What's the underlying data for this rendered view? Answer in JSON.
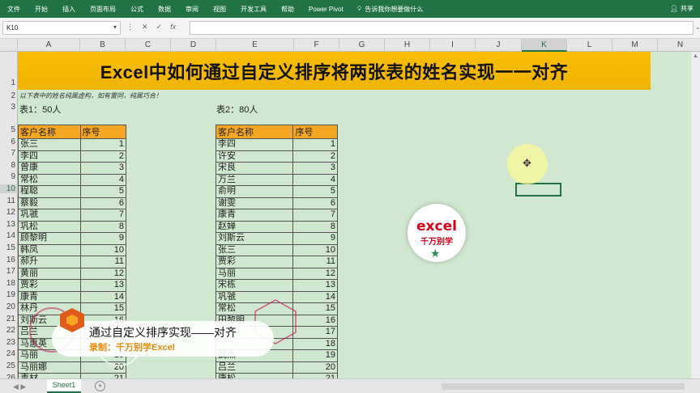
{
  "ribbon": {
    "tabs": [
      "文件",
      "开始",
      "插入",
      "页面布局",
      "公式",
      "数据",
      "审阅",
      "视图",
      "开发工具",
      "帮助",
      "Power Pivot"
    ],
    "tell_me": "告诉我你想要做什么",
    "share": "共享",
    "color": "#217346"
  },
  "formula_bar": {
    "name_box": "K10",
    "formula": ""
  },
  "columns": [
    "A",
    "B",
    "C",
    "D",
    "E",
    "F",
    "G",
    "H",
    "I",
    "J",
    "K",
    "L",
    "M",
    "N"
  ],
  "selected_column": "K",
  "rows": [
    "1",
    "2",
    "3",
    "5",
    "6",
    "7",
    "8",
    "9",
    "10",
    "11",
    "12",
    "13",
    "14",
    "15",
    "16",
    "17",
    "18",
    "19",
    "20",
    "21",
    "22",
    "23",
    "24",
    "25",
    "26"
  ],
  "selected_row": "10",
  "sheet": {
    "title": "Excel中如何通过自定义排序将两张表的姓名实现一一对齐",
    "note": "以下表中的姓名纯属虚构，如有雷同，纯属巧合！",
    "table1_label": "表1：50人",
    "table2_label": "表2：80人",
    "headers": [
      "客户名称",
      "序号"
    ],
    "table1": [
      [
        "张三",
        "1"
      ],
      [
        "李四",
        "2"
      ],
      [
        "曾康",
        "3"
      ],
      [
        "常松",
        "4"
      ],
      [
        "程聪",
        "5"
      ],
      [
        "蔡毅",
        "6"
      ],
      [
        "巩虢",
        "7"
      ],
      [
        "巩松",
        "8"
      ],
      [
        "顾黎明",
        "9"
      ],
      [
        "韩凤",
        "10"
      ],
      [
        "郝升",
        "11"
      ],
      [
        "黄丽",
        "12"
      ],
      [
        "贾彩",
        "13"
      ],
      [
        "康青",
        "14"
      ],
      [
        "林丹",
        "15"
      ],
      [
        "刘斯云",
        "16"
      ],
      [
        "吕兰",
        "17"
      ],
      [
        "马惠英",
        "18"
      ],
      [
        "马丽",
        "19"
      ],
      [
        "马丽娜",
        "20"
      ],
      [
        "毒材",
        "21"
      ]
    ],
    "table2": [
      [
        "李四",
        "1"
      ],
      [
        "许安",
        "2"
      ],
      [
        "宋良",
        "3"
      ],
      [
        "万兰",
        "4"
      ],
      [
        "俞明",
        "5"
      ],
      [
        "谢雯",
        "6"
      ],
      [
        "康青",
        "7"
      ],
      [
        "赵婵",
        "8"
      ],
      [
        "刘斯云",
        "9"
      ],
      [
        "张三",
        "10"
      ],
      [
        "贾彩",
        "11"
      ],
      [
        "马丽",
        "12"
      ],
      [
        "宋栋",
        "13"
      ],
      [
        "巩虢",
        "14"
      ],
      [
        "常松",
        "15"
      ],
      [
        "田黎明",
        "16"
      ],
      [
        "",
        "17"
      ],
      [
        "",
        "18"
      ],
      [
        "武杰",
        "19"
      ],
      [
        "吕兰",
        "20"
      ],
      [
        "唐松",
        "21"
      ]
    ],
    "header_color": "#f5a623",
    "title_color": "#f8bd06"
  },
  "overlay": {
    "logo_line1": "excel",
    "logo_line2": "千万别学",
    "caption_line1": "通过自定义排序实现——对齐",
    "caption_line2": "录制：千万别学Excel"
  },
  "status": {
    "sheet_tab": "Sheet1"
  }
}
